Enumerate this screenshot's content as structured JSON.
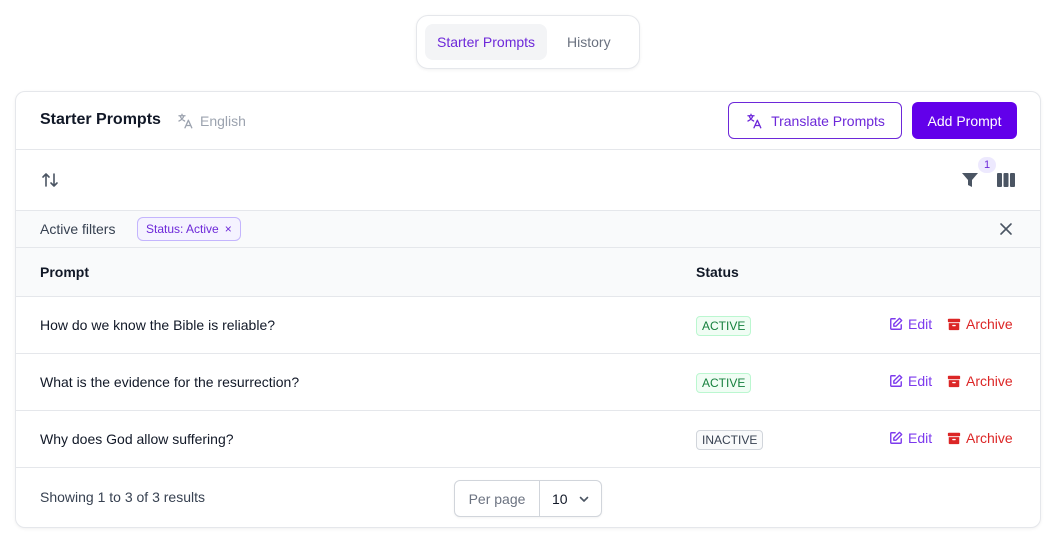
{
  "tabs": [
    {
      "label": "Starter Prompts",
      "active": true
    },
    {
      "label": "History",
      "active": false
    }
  ],
  "header": {
    "title": "Starter Prompts",
    "language": "English",
    "translate_label": "Translate Prompts",
    "add_label": "Add Prompt"
  },
  "toolbar": {
    "filter_count": "1"
  },
  "filters": {
    "label": "Active filters",
    "chip": "Status: Active",
    "chip_remove": "×"
  },
  "table": {
    "columns": [
      "Prompt",
      "Status"
    ],
    "rows": [
      {
        "prompt": "How do we know the Bible is reliable?",
        "status": "ACTIVE",
        "edit": "Edit",
        "archive": "Archive"
      },
      {
        "prompt": "What is the evidence for the resurrection?",
        "status": "ACTIVE",
        "edit": "Edit",
        "archive": "Archive"
      },
      {
        "prompt": "Why does God allow suffering?",
        "status": "INACTIVE",
        "edit": "Edit",
        "archive": "Archive"
      }
    ]
  },
  "footer": {
    "showing": "Showing 1 to 3 of 3 results",
    "per_page_label": "Per page",
    "per_page_value": "10"
  },
  "colors": {
    "accent": "#6200ea",
    "accent_text": "#6d28d9",
    "active_badge": "#15803d",
    "archive": "#dc2626"
  }
}
